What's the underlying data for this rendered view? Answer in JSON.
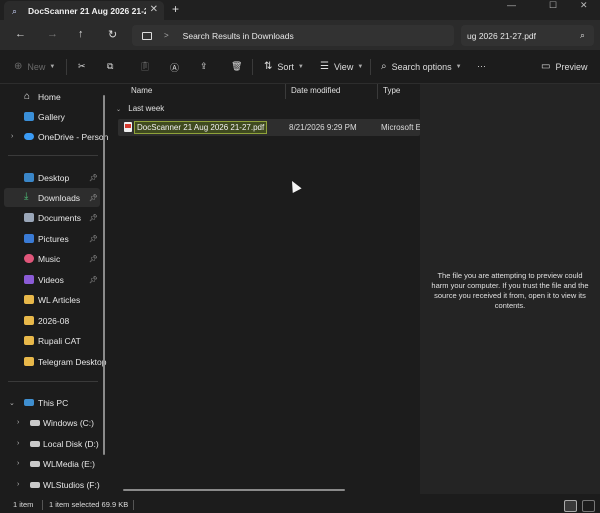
{
  "window": {
    "tab_title": "DocScanner 21 Aug 2026 21-2",
    "tab_icon": "search-icon",
    "new_tab": "+",
    "minimize": "—",
    "maximize": "☐",
    "close": "✕"
  },
  "address": {
    "path": "Search Results in Downloads",
    "separator": ">",
    "search_value": "ug 2026 21-27.pdf"
  },
  "toolbar": {
    "new_label": "New",
    "sort_label": "Sort",
    "view_label": "View",
    "search_options_label": "Search options",
    "more_label": "···",
    "preview_label": "Preview"
  },
  "sidebar": {
    "items": [
      {
        "label": "Home",
        "icon": "home-icon"
      },
      {
        "label": "Gallery",
        "icon": "gallery-icon"
      },
      {
        "label": "OneDrive - Person",
        "icon": "cloud-icon"
      },
      {
        "label": "Desktop",
        "icon": "desktop-icon"
      },
      {
        "label": "Downloads",
        "icon": "download-icon"
      },
      {
        "label": "Documents",
        "icon": "documents-icon"
      },
      {
        "label": "Pictures",
        "icon": "pictures-icon"
      },
      {
        "label": "Music",
        "icon": "music-icon"
      },
      {
        "label": "Videos",
        "icon": "videos-icon"
      },
      {
        "label": "WL Articles",
        "icon": "folder-icon"
      },
      {
        "label": "2026-08",
        "icon": "folder-icon"
      },
      {
        "label": "Rupali CAT",
        "icon": "folder-icon"
      },
      {
        "label": "Telegram Desktop",
        "icon": "folder-icon"
      },
      {
        "label": "This PC",
        "icon": "pc-icon"
      },
      {
        "label": "Windows (C:)",
        "icon": "drive-icon"
      },
      {
        "label": "Local Disk (D:)",
        "icon": "drive-icon"
      },
      {
        "label": "WLMedia (E:)",
        "icon": "drive-icon"
      },
      {
        "label": "WLStudios (F:)",
        "icon": "drive-icon"
      }
    ]
  },
  "filelist": {
    "columns": [
      "Name",
      "Date modified",
      "Type"
    ],
    "group": "Last week",
    "rows": [
      {
        "name": "DocScanner 21 Aug 2026 21-27.pdf",
        "date": "8/21/2026 9:29 PM",
        "type": "Microsoft E"
      }
    ]
  },
  "preview": {
    "message": "The file you are attempting to preview could harm your computer. If you trust the file and the source you received it from, open it to view its contents."
  },
  "status": {
    "item_count": "1 item",
    "selection": "1 item selected  69.9 KB"
  },
  "colors": {
    "background": "#1c1c1c",
    "selection_highlight": "#8fa23a",
    "preview_bg": "#242424"
  }
}
